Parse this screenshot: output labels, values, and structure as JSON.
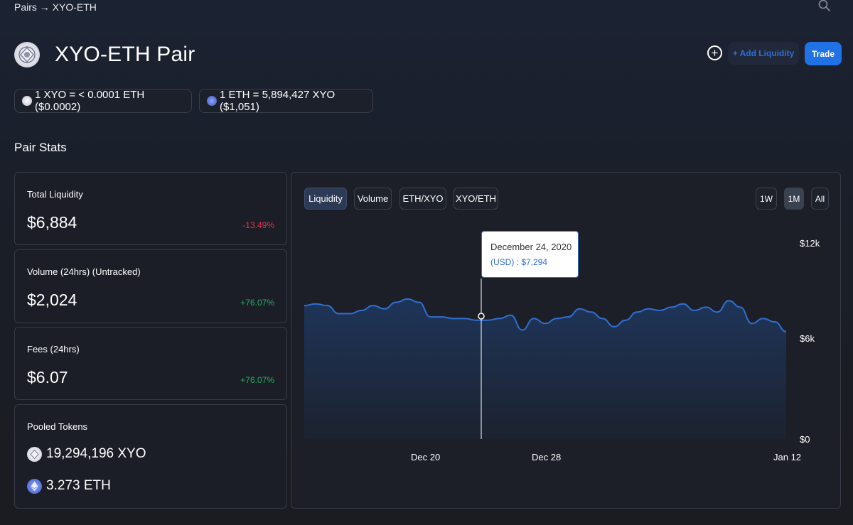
{
  "breadcrumb": "Pairs → XYO-ETH",
  "header": {
    "title": "XYO-ETH Pair",
    "add_liquidity_label": "+ Add Liquidity",
    "trade_label": "Trade",
    "add_icon_glyph": "+"
  },
  "rates": {
    "xyo_rate": "1 XYO = < 0.0001 ETH ($0.0002)",
    "eth_rate": "1 ETH = 5,894,427 XYO ($1,051)"
  },
  "stats": {
    "section_title": "Pair Stats",
    "total_liquidity": {
      "label": "Total Liquidity",
      "value": "$6,884",
      "change": "-13.49%"
    },
    "volume": {
      "label": "Volume (24hrs) (Untracked)",
      "value": "$2,024",
      "change": "+76.07%"
    },
    "fees": {
      "label": "Fees (24hrs)",
      "value": "$6.07",
      "change": "+76.07%"
    },
    "pooled": {
      "label": "Pooled Tokens",
      "xyo": "19,294,196 XYO",
      "eth": "3.273 ETH"
    }
  },
  "chart": {
    "tabs": [
      "Liquidity",
      "Volume",
      "ETH/XYO",
      "XYO/ETH"
    ],
    "active_tab": "Liquidity",
    "ranges": [
      "1W",
      "1M",
      "All"
    ],
    "active_range": "1M",
    "tooltip": {
      "date": "December 24, 2020",
      "value": "(USD) : $7,294"
    },
    "colors": {
      "line": "#2f6fd2",
      "area_top": "#1e3559",
      "area_bottom": "#1c222f"
    }
  },
  "chart_data": {
    "type": "area",
    "series_label": "Liquidity (USD)",
    "x_ticks": [
      "Dec 20",
      "Dec 28",
      "Jan 12"
    ],
    "y_ticks": [
      "$0",
      "$6k",
      "$12k"
    ],
    "ylim": [
      0,
      12000
    ],
    "values": [
      8200,
      8300,
      8200,
      7700,
      7700,
      7900,
      8200,
      8000,
      8400,
      8600,
      8400,
      7500,
      7500,
      7400,
      7400,
      7300,
      7300,
      7400,
      7600,
      6700,
      7400,
      7100,
      7400,
      7500,
      8000,
      7800,
      7400,
      6900,
      7300,
      7800,
      8000,
      7900,
      8100,
      8300,
      7900,
      8100,
      7800,
      8500,
      8100,
      7100,
      7400,
      7200,
      6600
    ]
  }
}
